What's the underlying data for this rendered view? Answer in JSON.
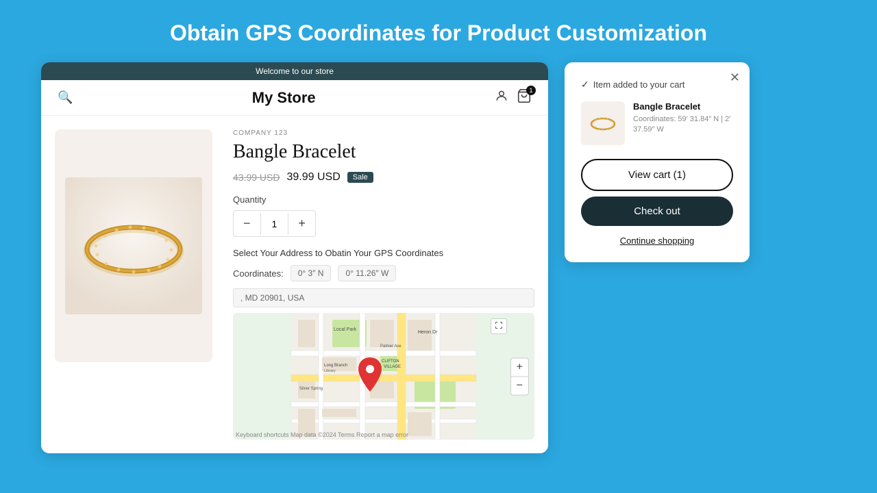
{
  "page": {
    "title": "Obtain GPS Coordinates for Product Customization",
    "background_color": "#2ba8e0"
  },
  "store": {
    "topbar_message": "Welcome to our store",
    "name": "My Store",
    "company_label": "COMPANY 123",
    "product": {
      "title": "Bangle Bracelet",
      "price_original": "43.99 USD",
      "price_sale": "39.99 USD",
      "sale_label": "Sale",
      "quantity_label": "Quantity",
      "quantity_value": "1",
      "address_section_label": "Select Your Address to Obatin Your GPS Coordinates",
      "coordinates_label": "Coordinates:",
      "coord_lat": "0° 3″ N",
      "coord_lng": "0° 11.26″ W",
      "address_value": ", MD 20901, USA"
    }
  },
  "cart_popup": {
    "added_message": "Item added to your cart",
    "item_name": "Bangle Bracelet",
    "item_coords": "Coordinates:  59′ 31.84″ N |  2′ 37.59″ W",
    "view_cart_label": "View cart (1)",
    "checkout_label": "Check out",
    "continue_label": "Continue shopping"
  },
  "map": {
    "zoom_in": "+",
    "zoom_out": "−",
    "attribution": "Keyboard shortcuts  Map data ©2024  Terms  Report a map error"
  },
  "icons": {
    "search": "🔍",
    "user": "👤",
    "cart": "🛍",
    "cart_count": "1",
    "close": "✕",
    "expand": "⤢",
    "check": "✓",
    "pin": "📍"
  }
}
